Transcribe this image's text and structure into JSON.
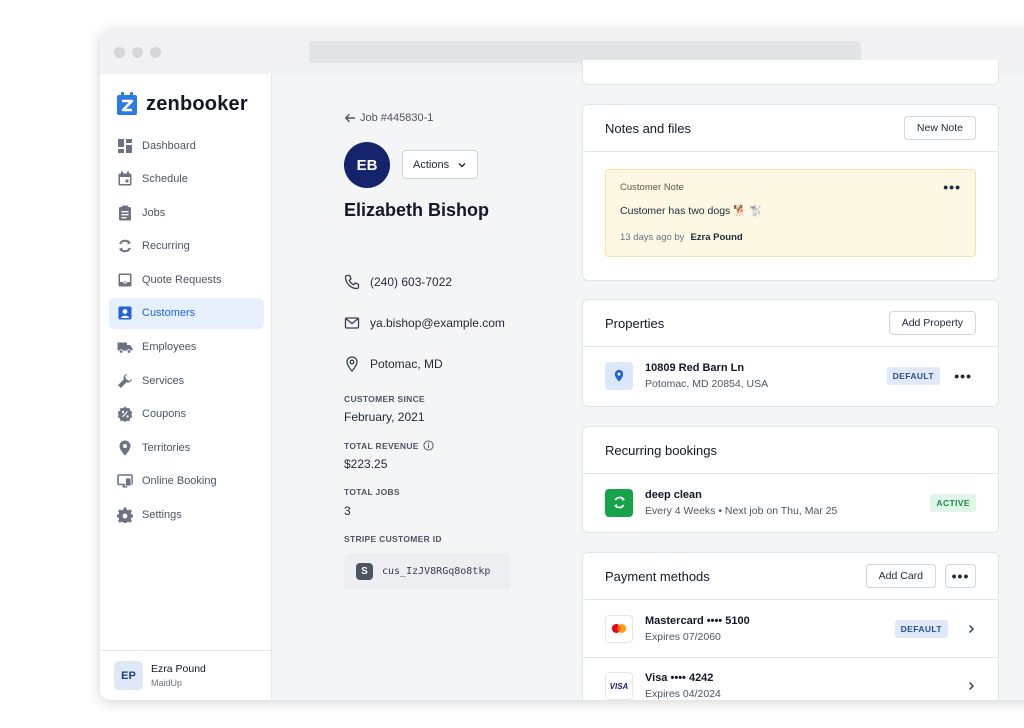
{
  "app": {
    "name": "zenbooker"
  },
  "sidebar": {
    "items": [
      {
        "label": "Dashboard",
        "icon": "dashboard-icon"
      },
      {
        "label": "Schedule",
        "icon": "calendar-icon"
      },
      {
        "label": "Jobs",
        "icon": "clipboard-icon"
      },
      {
        "label": "Recurring",
        "icon": "recurring-icon"
      },
      {
        "label": "Quote Requests",
        "icon": "inbox-icon"
      },
      {
        "label": "Customers",
        "icon": "customer-icon",
        "active": true
      },
      {
        "label": "Employees",
        "icon": "truck-icon"
      },
      {
        "label": "Services",
        "icon": "wrench-icon"
      },
      {
        "label": "Coupons",
        "icon": "coupon-icon"
      },
      {
        "label": "Territories",
        "icon": "pin-icon"
      },
      {
        "label": "Online Booking",
        "icon": "online-booking-icon"
      },
      {
        "label": "Settings",
        "icon": "gear-icon"
      }
    ],
    "user": {
      "initials": "EP",
      "name": "Ezra Pound",
      "org": "MaidUp"
    }
  },
  "customer": {
    "back_label": "Job #445830-1",
    "initials": "EB",
    "actions_label": "Actions",
    "name": "Elizabeth Bishop",
    "phone": "(240) 603-7022",
    "email": "ya.bishop@example.com",
    "location": "Potomac, MD",
    "since_label": "CUSTOMER SINCE",
    "since_value": "February, 2021",
    "revenue_label": "TOTAL REVENUE",
    "revenue_value": "$223.25",
    "jobs_label": "TOTAL JOBS",
    "jobs_value": "3",
    "stripe_label": "STRIPE CUSTOMER ID",
    "stripe_id": "cus_IzJV8RGq8o8tkp"
  },
  "notes": {
    "title": "Notes and files",
    "new_label": "New Note",
    "note": {
      "label": "Customer Note",
      "body": "Customer has two dogs 🐕 🐩",
      "time": "13 days ago by",
      "author": "Ezra Pound"
    }
  },
  "properties": {
    "title": "Properties",
    "add_label": "Add Property",
    "items": [
      {
        "address": "10809 Red Barn Ln",
        "city": "Potomac, MD 20854, USA",
        "badge": "DEFAULT"
      }
    ]
  },
  "recurring": {
    "title": "Recurring bookings",
    "items": [
      {
        "name": "deep clean",
        "schedule": "Every 4 Weeks • Next job on Thu, Mar 25",
        "badge": "ACTIVE"
      }
    ]
  },
  "payments": {
    "title": "Payment methods",
    "add_label": "Add Card",
    "items": [
      {
        "brand": "Mastercard •••• 5100",
        "expires": "Expires 07/2060",
        "badge": "DEFAULT",
        "icon": "mastercard-icon"
      },
      {
        "brand": "Visa •••• 4242",
        "expires": "Expires 04/2024",
        "badge": "",
        "icon": "visa-icon",
        "logo_text": "VISA"
      }
    ]
  },
  "colors": {
    "accent": "#1f63d6",
    "avatar": "#15236b",
    "note_bg": "#fdf8e3",
    "active_green": "#1a8a4d"
  }
}
